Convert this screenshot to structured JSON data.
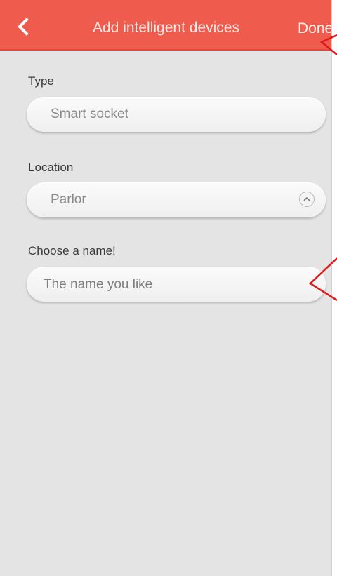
{
  "header": {
    "title": "Add intelligent devices",
    "done_label": "Done",
    "back_icon": "chevron-left-icon",
    "background_color": "#ef5b4c"
  },
  "form": {
    "type": {
      "label": "Type",
      "value": "Smart socket"
    },
    "location": {
      "label": "Location",
      "value": "Parlor",
      "expand_icon": "chevron-up-icon"
    },
    "name": {
      "label": "Choose a name!",
      "placeholder": "The name you like",
      "value": ""
    }
  },
  "annotations": {
    "color": "#e01818"
  }
}
